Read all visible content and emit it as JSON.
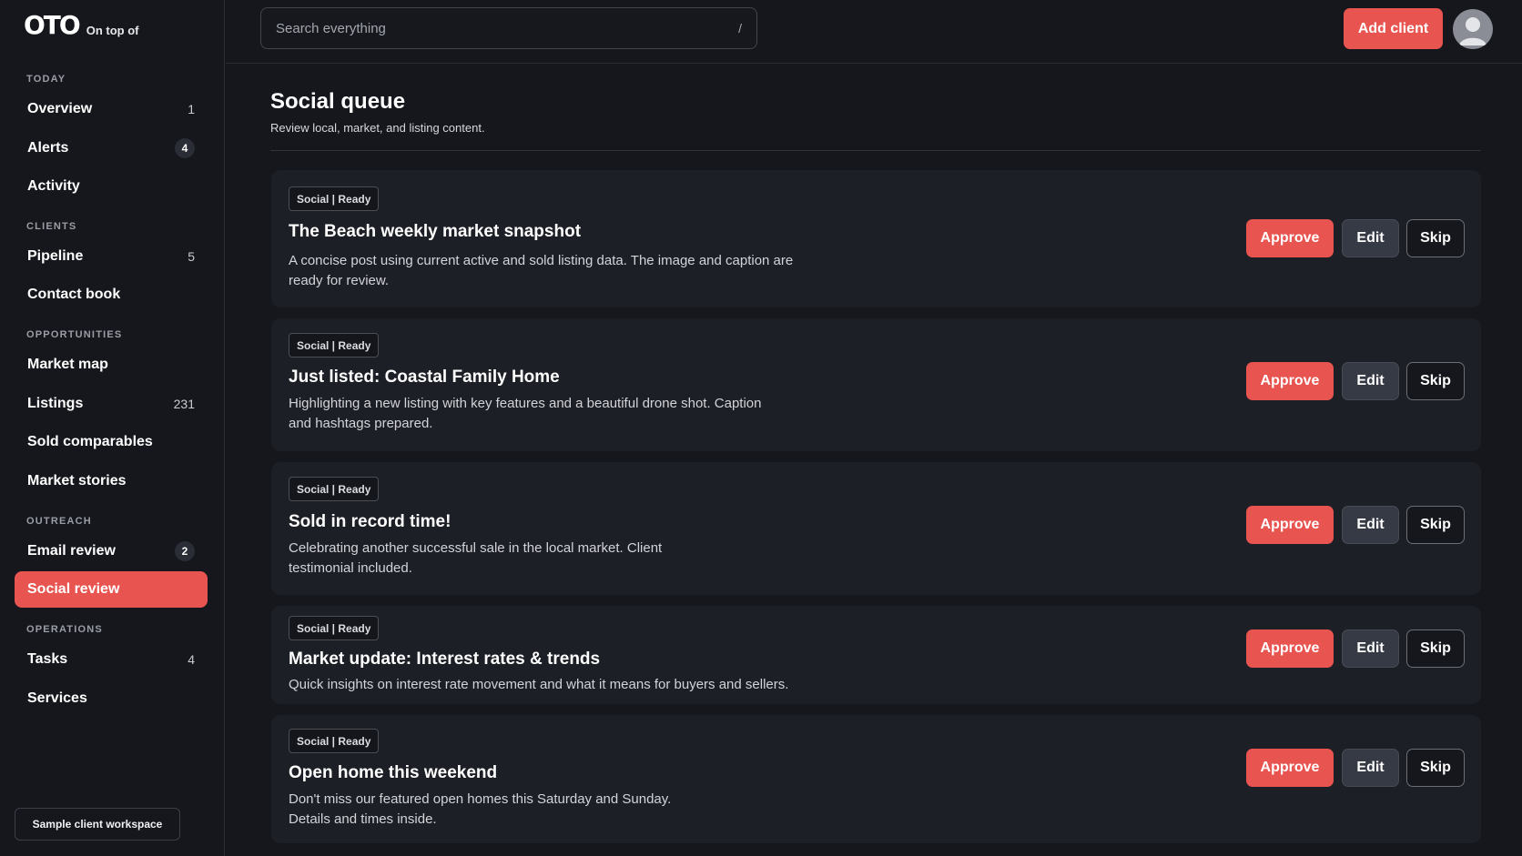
{
  "brand": {
    "logo": "OTO",
    "tagline": "On top of"
  },
  "sidebar": {
    "sections": {
      "today": "TODAY",
      "clients": "CLIENTS",
      "opportunities": "OPPORTUNITIES",
      "outreach": "OUTREACH",
      "operations": "OPERATIONS"
    },
    "items": {
      "overview": {
        "label": "Overview",
        "count": "1"
      },
      "alerts": {
        "label": "Alerts",
        "badge": "4"
      },
      "activity": {
        "label": "Activity"
      },
      "pipeline": {
        "label": "Pipeline",
        "count": "5"
      },
      "contact_book": {
        "label": "Contact book"
      },
      "market_map": {
        "label": "Market map"
      },
      "listings": {
        "label": "Listings",
        "count": "231"
      },
      "sold_comparables": {
        "label": "Sold comparables"
      },
      "market_stories": {
        "label": "Market stories"
      },
      "email_review": {
        "label": "Email review",
        "badge": "2"
      },
      "social_review": {
        "label": "Social review",
        "active": true
      },
      "tasks": {
        "label": "Tasks",
        "count": "4"
      },
      "services": {
        "label": "Services"
      }
    },
    "workspace_label": "Sample client workspace"
  },
  "topbar": {
    "search_placeholder": "Search everything",
    "search_shortcut": "/",
    "add_client_label": "Add client",
    "avatar_icon": "user-avatar-icon"
  },
  "main": {
    "title": "Social queue",
    "subtitle": "Review local, market, and listing content.",
    "cards": [
      {
        "tag": "Social | Ready",
        "title": "The Beach weekly market snapshot",
        "desc": "A concise post using current active and sold listing data. The image and caption are ready for review."
      },
      {
        "tag": "Social | Ready",
        "title": "Just listed: Coastal Family Home",
        "desc": "Highlighting a new listing with key features and a beautiful drone shot. Caption and hashtags prepared."
      },
      {
        "tag": "Social | Ready",
        "title": "Sold in record time!",
        "desc": "Celebrating another successful sale in the local market. Client testimonial included."
      },
      {
        "tag": "Social | Ready",
        "title": "Market update: Interest rates & trends",
        "desc": "Quick insights on interest rate movement and what it means for buyers and sellers."
      },
      {
        "tag": "Social | Ready",
        "title": "Open home this weekend",
        "desc": "Don't miss our featured open homes this Saturday and Sunday. Details and times inside."
      }
    ],
    "actions": {
      "approve": "Approve",
      "edit": "Edit",
      "skip": "Skip"
    }
  },
  "colors": {
    "accent": "#e8544f",
    "background": "#15171d",
    "card": "#1d1f26"
  }
}
